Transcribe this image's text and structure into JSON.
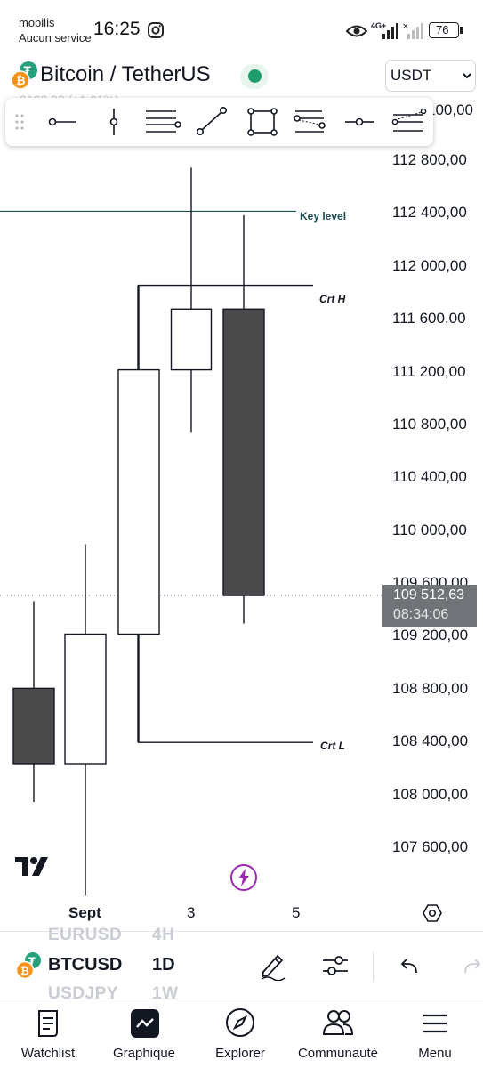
{
  "status_bar": {
    "carrier": "mobilis",
    "service": "Aucun service",
    "time": "16:25",
    "network": "4G+",
    "battery": "76"
  },
  "header": {
    "title": "Bitcoin / TetherUS",
    "subtitle_partial": "9100,00 (+1,01%)",
    "currency": "USDT"
  },
  "drawing_toolbar": {
    "tools": [
      "horizontal-ray-icon",
      "vertical-line-icon",
      "fib-levels-icon",
      "trend-line-icon",
      "rectangle-icon",
      "fib-extension-icon",
      "horizontal-line-icon",
      "parallel-channel-icon"
    ]
  },
  "price_axis": {
    "top_partial": "100,00",
    "labels": [
      "112 800,00",
      "112 400,00",
      "112 000,00",
      "111 600,00",
      "111 200,00",
      "110 800,00",
      "110 400,00",
      "110 000,00",
      "109 600,00",
      "109 200,00",
      "108 800,00",
      "108 400,00",
      "108 000,00",
      "107 600,00"
    ],
    "current_price": "109 512,63",
    "countdown": "08:34:06"
  },
  "annotations": {
    "key_level": "Key level",
    "crt_high": "Crt H",
    "crt_low": "Crt L"
  },
  "time_axis": {
    "labels": [
      "Sept",
      "3",
      "5"
    ]
  },
  "chart_data": {
    "type": "candlestick",
    "candles": [
      {
        "open": 108810,
        "high": 109470,
        "low": 107950,
        "close": 108240,
        "direction": "down"
      },
      {
        "open": 108240,
        "high": 109900,
        "low": 107240,
        "close": 109220,
        "direction": "up"
      },
      {
        "open": 109220,
        "high": 111860,
        "low": 108400,
        "close": 111220,
        "direction": "up"
      },
      {
        "open": 111220,
        "high": 112750,
        "low": 110750,
        "close": 111680,
        "direction": "up"
      },
      {
        "open": 111680,
        "high": 112390,
        "low": 109300,
        "close": 109512.63,
        "direction": "down"
      }
    ],
    "key_level": 112420,
    "crt_high": 111860,
    "crt_low": 108400,
    "current_price": 109512.63,
    "colors": {
      "up": "#ffffff",
      "down": "#4a4a4a",
      "key_level": "#1b4f54"
    }
  },
  "bottom_symbols": {
    "prev_symbol": "EURUSD",
    "prev_interval": "4H",
    "symbol": "BTCUSD",
    "interval": "1D",
    "next_symbol": "USDJPY",
    "next_interval": "1W"
  },
  "bottom_nav": {
    "items": [
      {
        "label": "Watchlist",
        "icon": "list-icon"
      },
      {
        "label": "Graphique",
        "icon": "chart-icon"
      },
      {
        "label": "Explorer",
        "icon": "compass-icon"
      },
      {
        "label": "Communauté",
        "icon": "people-icon"
      },
      {
        "label": "Menu",
        "icon": "menu-icon"
      }
    ]
  }
}
